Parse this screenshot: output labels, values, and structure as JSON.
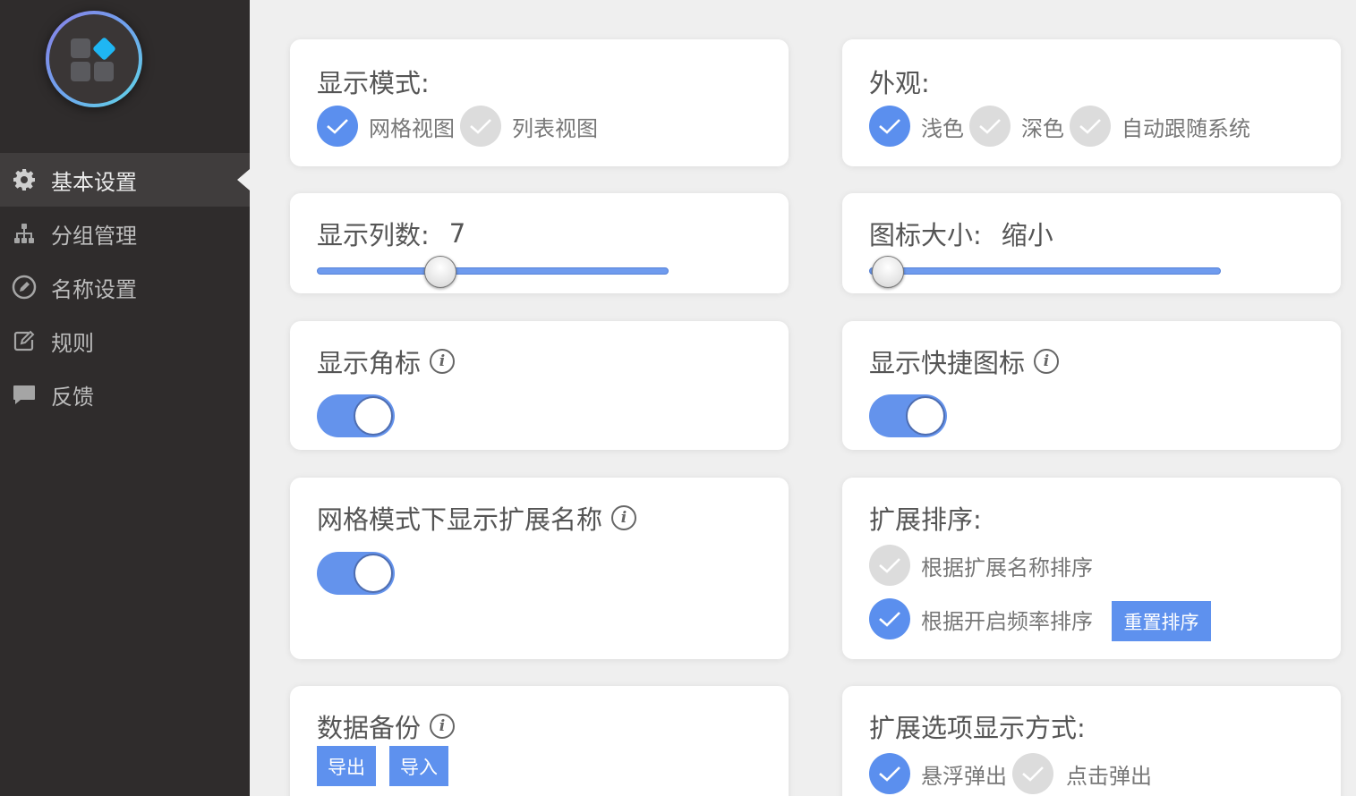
{
  "sidebar": {
    "items": [
      {
        "label": "基本设置",
        "icon": "gear-icon",
        "active": true
      },
      {
        "label": "分组管理",
        "icon": "sitemap-icon",
        "active": false
      },
      {
        "label": "名称设置",
        "icon": "pencil-circle-icon",
        "active": false
      },
      {
        "label": "规则",
        "icon": "edit-square-icon",
        "active": false
      },
      {
        "label": "反馈",
        "icon": "comment-icon",
        "active": false
      }
    ]
  },
  "display_mode": {
    "title": "显示模式:",
    "options": [
      "网格视图",
      "列表视图"
    ],
    "selected": "网格视图"
  },
  "appearance": {
    "title": "外观:",
    "options": [
      "浅色",
      "深色",
      "自动跟随系统"
    ],
    "selected": "浅色"
  },
  "columns": {
    "title": "显示列数:",
    "value": "7",
    "slider_fraction": 0.35
  },
  "icon_size": {
    "title": "图标大小:",
    "value": "缩小",
    "slider_fraction": 0.05
  },
  "show_badge": {
    "title": "显示角标",
    "enabled": true
  },
  "show_shortcut": {
    "title": "显示快捷图标",
    "enabled": true
  },
  "grid_names": {
    "title": "网格模式下显示扩展名称",
    "enabled": true
  },
  "sort": {
    "title": "扩展排序:",
    "options": [
      "根据扩展名称排序",
      "根据开启频率排序"
    ],
    "selected": "根据开启频率排序",
    "reset_label": "重置排序"
  },
  "backup": {
    "title": "数据备份",
    "export_label": "导出",
    "import_label": "导入"
  },
  "option_display": {
    "title": "扩展选项显示方式:",
    "options": [
      "悬浮弹出",
      "点击弹出"
    ],
    "selected": "悬浮弹出"
  },
  "colors": {
    "accent": "#5b8fee",
    "sidebar": "#2f2c2c",
    "background": "#efefef"
  }
}
